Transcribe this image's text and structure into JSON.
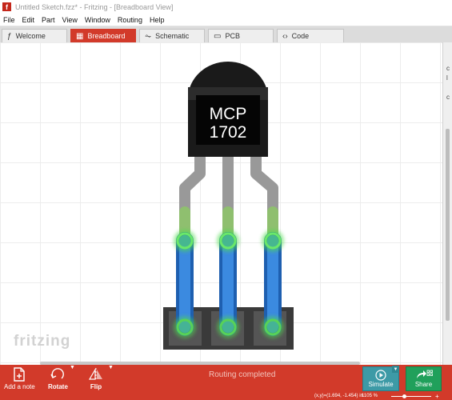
{
  "window": {
    "title": "Untitled Sketch.fzz* - Fritzing - [Breadboard View]",
    "app_icon": "f"
  },
  "menu": [
    "File",
    "Edit",
    "Part",
    "View",
    "Window",
    "Routing",
    "Help"
  ],
  "tabs": [
    {
      "label": "Welcome",
      "icon": "fritzing-f-icon",
      "active": false
    },
    {
      "label": "Breadboard",
      "icon": "breadboard-icon",
      "active": true
    },
    {
      "label": "Schematic",
      "icon": "schematic-icon",
      "active": false
    },
    {
      "label": "PCB",
      "icon": "pcb-icon",
      "active": false
    },
    {
      "label": "Code",
      "icon": "code-icon",
      "active": false
    }
  ],
  "part": {
    "line1": "MCP",
    "line2": "1702"
  },
  "watermark": "fritzing",
  "toolbar": {
    "add_note": "Add a note",
    "rotate": "Rotate",
    "flip": "Flip",
    "status": "Routing completed",
    "simulate": "Simulate",
    "share": "Share"
  },
  "statusbar": {
    "coords": "(x,y)=(1.694, -1.454) in",
    "zoom": "1105 %"
  },
  "colors": {
    "accent": "#d23a2a",
    "simulate": "#3d9aa6",
    "share": "#20a05b",
    "wire": "#2b7fd6",
    "connector_glow": "#4fdc4f",
    "leg": "#9a9a9a",
    "header": "#3c3c3c"
  }
}
